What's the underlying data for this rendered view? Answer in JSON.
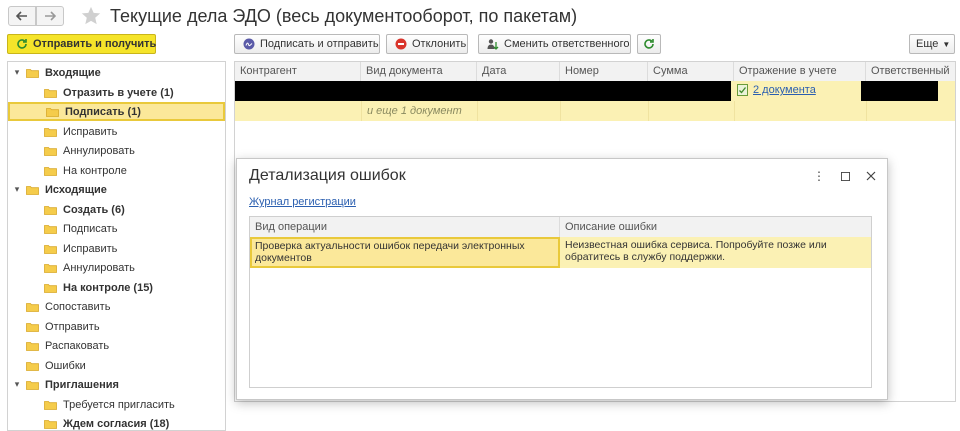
{
  "window": {
    "title": "Текущие дела ЭДО (весь документооборот, по пакетам)"
  },
  "toolbar": {
    "send_receive": "Отправить и получить",
    "sign_send": "Подписать и отправить",
    "reject": "Отклонить",
    "change_responsible": "Сменить ответственного",
    "more": "Еще"
  },
  "sidebar": {
    "items": [
      {
        "label": "Входящие",
        "level": 0,
        "bold": true,
        "expanded": true
      },
      {
        "label": "Отразить в учете (1)",
        "level": 1,
        "bold": true
      },
      {
        "label": "Подписать (1)",
        "level": 1,
        "bold": true,
        "selected": true
      },
      {
        "label": "Исправить",
        "level": 1
      },
      {
        "label": "Аннулировать",
        "level": 1
      },
      {
        "label": "На контроле",
        "level": 1
      },
      {
        "label": "Исходящие",
        "level": 0,
        "bold": true,
        "expanded": true
      },
      {
        "label": "Создать (6)",
        "level": 1,
        "bold": true
      },
      {
        "label": "Подписать",
        "level": 1
      },
      {
        "label": "Исправить",
        "level": 1
      },
      {
        "label": "Аннулировать",
        "level": 1
      },
      {
        "label": "На контроле (15)",
        "level": 1,
        "bold": true
      },
      {
        "label": "Сопоставить",
        "level": 0
      },
      {
        "label": "Отправить",
        "level": 0
      },
      {
        "label": "Распаковать",
        "level": 0
      },
      {
        "label": "Ошибки",
        "level": 0
      },
      {
        "label": "Приглашения",
        "level": 0,
        "bold": true,
        "expanded": true
      },
      {
        "label": "Требуется пригласить",
        "level": 1
      },
      {
        "label": "Ждем согласия (18)",
        "level": 1,
        "bold": true
      }
    ]
  },
  "grid": {
    "columns": [
      "Контрагент",
      "Вид документа",
      "Дата",
      "Номер",
      "Сумма",
      "Отражение в учете",
      "Ответственный"
    ],
    "row1_link": "2 документа",
    "row2_note": "и еще 1 документ"
  },
  "dialog": {
    "title": "Детализация ошибок",
    "journal_link": "Журнал регистрации",
    "columns": [
      "Вид операции",
      "Описание ошибки"
    ],
    "rows": [
      {
        "operation": "Проверка актуальности ошибок передачи электронных документов",
        "description": "Неизвестная ошибка сервиса. Попробуйте позже или обратитесь в службу поддержки."
      }
    ]
  }
}
